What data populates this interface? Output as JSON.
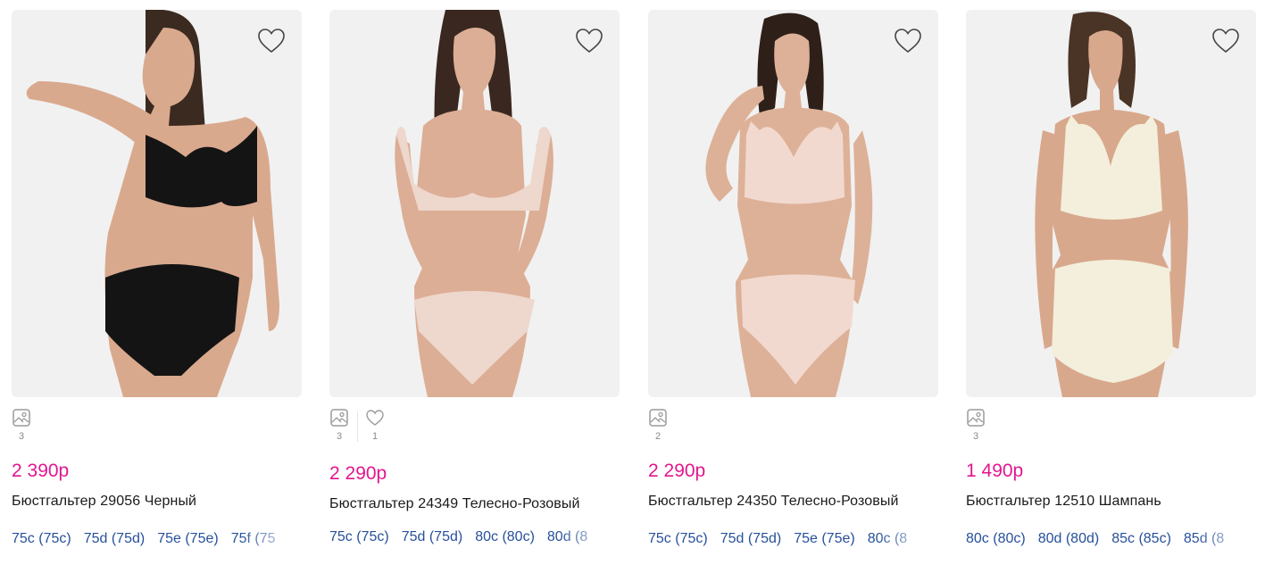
{
  "products": [
    {
      "price": "2 390р",
      "name": "Бюстгальтер 29056 Черный",
      "photos": "3",
      "likes": null,
      "sizes": [
        "75c (75c)",
        "75d (75d)",
        "75e (75e)",
        "75f (75"
      ],
      "garment_color": "#141414",
      "skin_color": "#d9a98e",
      "hair_color": "#3b2a20"
    },
    {
      "price": "2 290р",
      "name": "Бюстгальтер 24349 Телесно-Розовый",
      "photos": "3",
      "likes": "1",
      "sizes": [
        "75c (75c)",
        "75d (75d)",
        "80c (80c)",
        "80d (8"
      ],
      "garment_color": "#eed7cc",
      "skin_color": "#dcae95",
      "hair_color": "#3a2820"
    },
    {
      "price": "2 290р",
      "name": "Бюстгальтер 24350 Телесно-Розовый",
      "photos": "2",
      "likes": null,
      "sizes": [
        "75c (75c)",
        "75d (75d)",
        "75e (75e)",
        "80c (8"
      ],
      "garment_color": "#f2d9cf",
      "skin_color": "#ddb198",
      "hair_color": "#2e2018"
    },
    {
      "price": "1 490р",
      "name": "Бюстгальтер 12510 Шампань",
      "photos": "3",
      "likes": null,
      "sizes": [
        "80c (80c)",
        "80d (80d)",
        "85c (85c)",
        "85d (8"
      ],
      "garment_color": "#f3efdc",
      "skin_color": "#d8a88d",
      "hair_color": "#4a3426"
    }
  ],
  "colors": {
    "price": "#e3168f",
    "size_link": "#27509b",
    "image_bg": "#f1f1f1",
    "meta_icon": "#9a9a9a"
  }
}
